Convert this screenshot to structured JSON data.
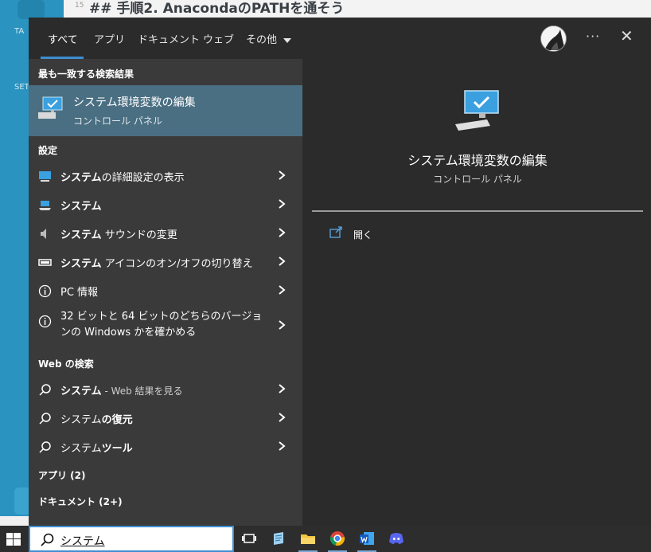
{
  "background_app": {
    "line_number": "15",
    "markdown_heading": "## 手順2. AnacondaのPATHを通そう",
    "sidebar_labels": [
      "TA",
      "SET"
    ]
  },
  "tabs": [
    {
      "label": "すべて",
      "active": true
    },
    {
      "label": "アプリ"
    },
    {
      "label": "ドキュメント"
    },
    {
      "label": "ウェブ"
    },
    {
      "label": "その他"
    }
  ],
  "more_label": "···",
  "close_label": "✕",
  "best_match": {
    "section": "最も一致する検索結果",
    "title": "システム環境変数の編集",
    "subtitle": "コントロール パネル",
    "icon": "monitor-check-icon"
  },
  "settings": {
    "section": "設定",
    "items": [
      {
        "bold": "システム",
        "rest": "の詳細設定の表示",
        "icon": "monitor-settings-icon"
      },
      {
        "bold": "システム",
        "rest": "",
        "icon": "laptop-icon"
      },
      {
        "bold": "システム",
        "rest": " サウンドの変更",
        "icon": "speaker-icon"
      },
      {
        "bold": "システム",
        "rest": " アイコンのオン/オフの切り替え",
        "icon": "toggle-icon"
      },
      {
        "bold": "",
        "rest": "PC 情報",
        "icon": "info-icon"
      },
      {
        "bold": "",
        "rest": "32 ビットと 64 ビットのどちらのバージョンの Windows かを確かめる",
        "icon": "info-icon"
      }
    ]
  },
  "web": {
    "section": "Web の検索",
    "items": [
      {
        "bold": "システム",
        "rest": " - Web 結果を見る"
      },
      {
        "bold": "システム",
        "rest": "の復元"
      },
      {
        "bold": "システム",
        "rest": "ツール"
      }
    ]
  },
  "apps_section": "アプリ (2)",
  "documents_section": "ドキュメント (2+)",
  "detail": {
    "title": "システム環境変数の編集",
    "subtitle": "コントロール パネル",
    "open_label": "開く"
  },
  "taskbar": {
    "search_value": "システム",
    "apps": [
      "task-view-icon",
      "notepad-icon",
      "file-explorer-icon",
      "chrome-icon",
      "word-icon",
      "discord-icon"
    ]
  },
  "colors": {
    "accent": "#3e8ed0",
    "best_match_bg": "#4a6f82",
    "panel_bg": "#2b2b2b",
    "list_bg": "#3a3a3a"
  }
}
